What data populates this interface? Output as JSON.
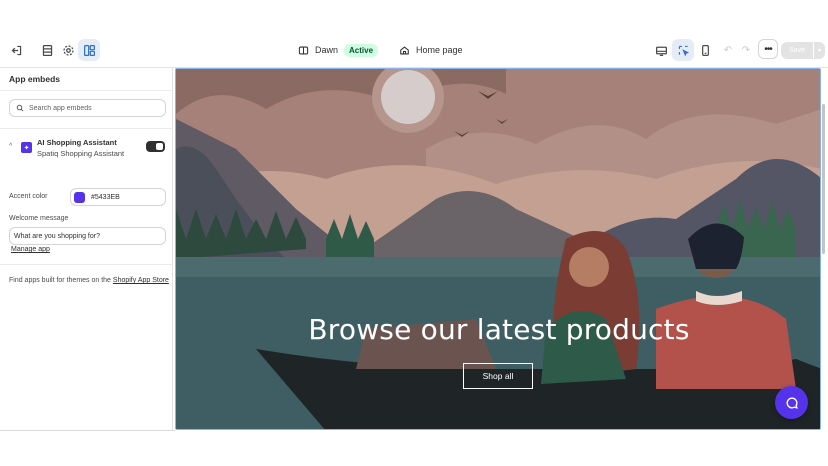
{
  "topbar": {
    "theme_name": "Dawn",
    "theme_status": "Active",
    "page_name": "Home page",
    "save_label": "Save",
    "more_label": "•••",
    "icons": [
      "exit-icon",
      "sections-icon",
      "settings-icon",
      "app-embeds-icon",
      "desktop-icon",
      "inspector-icon",
      "mobile-icon",
      "undo-icon",
      "redo-icon"
    ]
  },
  "sidebar": {
    "title": "App embeds",
    "search_placeholder": "Search app embeds",
    "embed": {
      "name": "AI Shopping Assistant",
      "provider": "Spatiq Shopping Assistant",
      "enabled": true
    },
    "accent_label": "Accent color",
    "accent_value": "#5433EB",
    "accent_color": "#5433eb",
    "welcome_label": "Welcome message",
    "welcome_value": "What are you shopping for?",
    "manage_link": "Manage app",
    "footer_text": "Find apps built for themes on the ",
    "footer_link": "Shopify App Store"
  },
  "preview": {
    "heading": "Browse our latest products",
    "button": "Shop all",
    "chat_color": "#5433eb"
  }
}
